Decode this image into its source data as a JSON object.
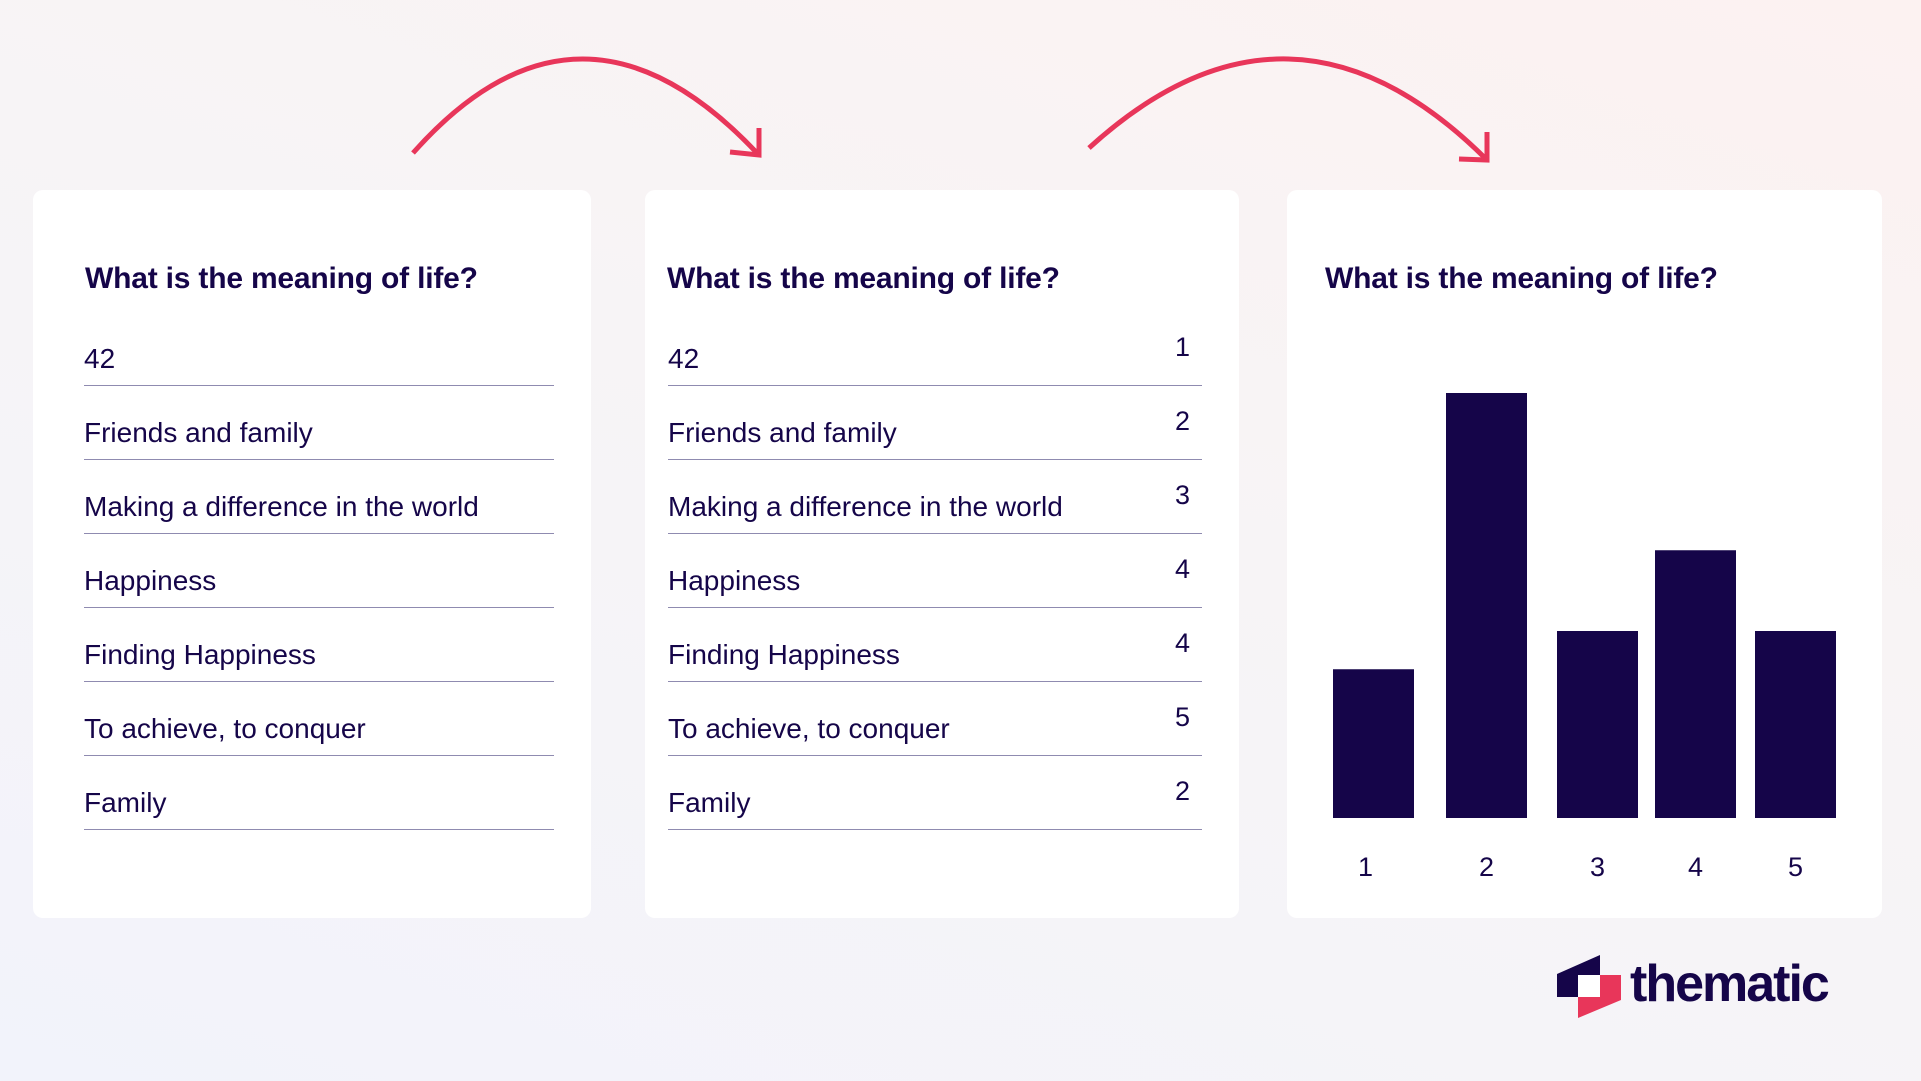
{
  "colors": {
    "navy": "#150549",
    "accent_pink": "#e8365a",
    "divider": "#8f8bb0",
    "card_bg": "#ffffff"
  },
  "cards": [
    {
      "title": "What is the meaning of life?",
      "rows": [
        {
          "text": "42"
        },
        {
          "text": "Friends and family"
        },
        {
          "text": "Making a difference in the world"
        },
        {
          "text": "Happiness"
        },
        {
          "text": "Finding Happiness"
        },
        {
          "text": "To achieve, to conquer"
        },
        {
          "text": "Family"
        }
      ]
    },
    {
      "title": "What is the meaning of life?",
      "rows": [
        {
          "text": "42",
          "code": "1"
        },
        {
          "text": "Friends and family",
          "code": "2"
        },
        {
          "text": "Making a difference in the world",
          "code": "3"
        },
        {
          "text": "Happiness",
          "code": "4"
        },
        {
          "text": "Finding Happiness",
          "code": "4"
        },
        {
          "text": "To achieve, to conquer",
          "code": "5"
        },
        {
          "text": "Family",
          "code": "2"
        }
      ]
    },
    {
      "title": "What is the meaning of life?"
    }
  ],
  "chart_data": {
    "type": "bar",
    "title": "What is the meaning of life?",
    "categories": [
      "1",
      "2",
      "3",
      "4",
      "5"
    ],
    "values": [
      3.5,
      10,
      4.4,
      6.3,
      4.4
    ],
    "xlabel": "",
    "ylabel": "",
    "ylim": [
      0,
      10
    ],
    "grid": false,
    "legend": "none",
    "bar_color": "#150549"
  },
  "arrows": [
    {
      "from": "raw-responses",
      "to": "coded-responses",
      "icon": "curved-arrow-icon"
    },
    {
      "from": "coded-responses",
      "to": "bar-chart",
      "icon": "curved-arrow-icon"
    }
  ],
  "logo": {
    "text": "thematic",
    "icon": "thematic-logo-icon"
  }
}
